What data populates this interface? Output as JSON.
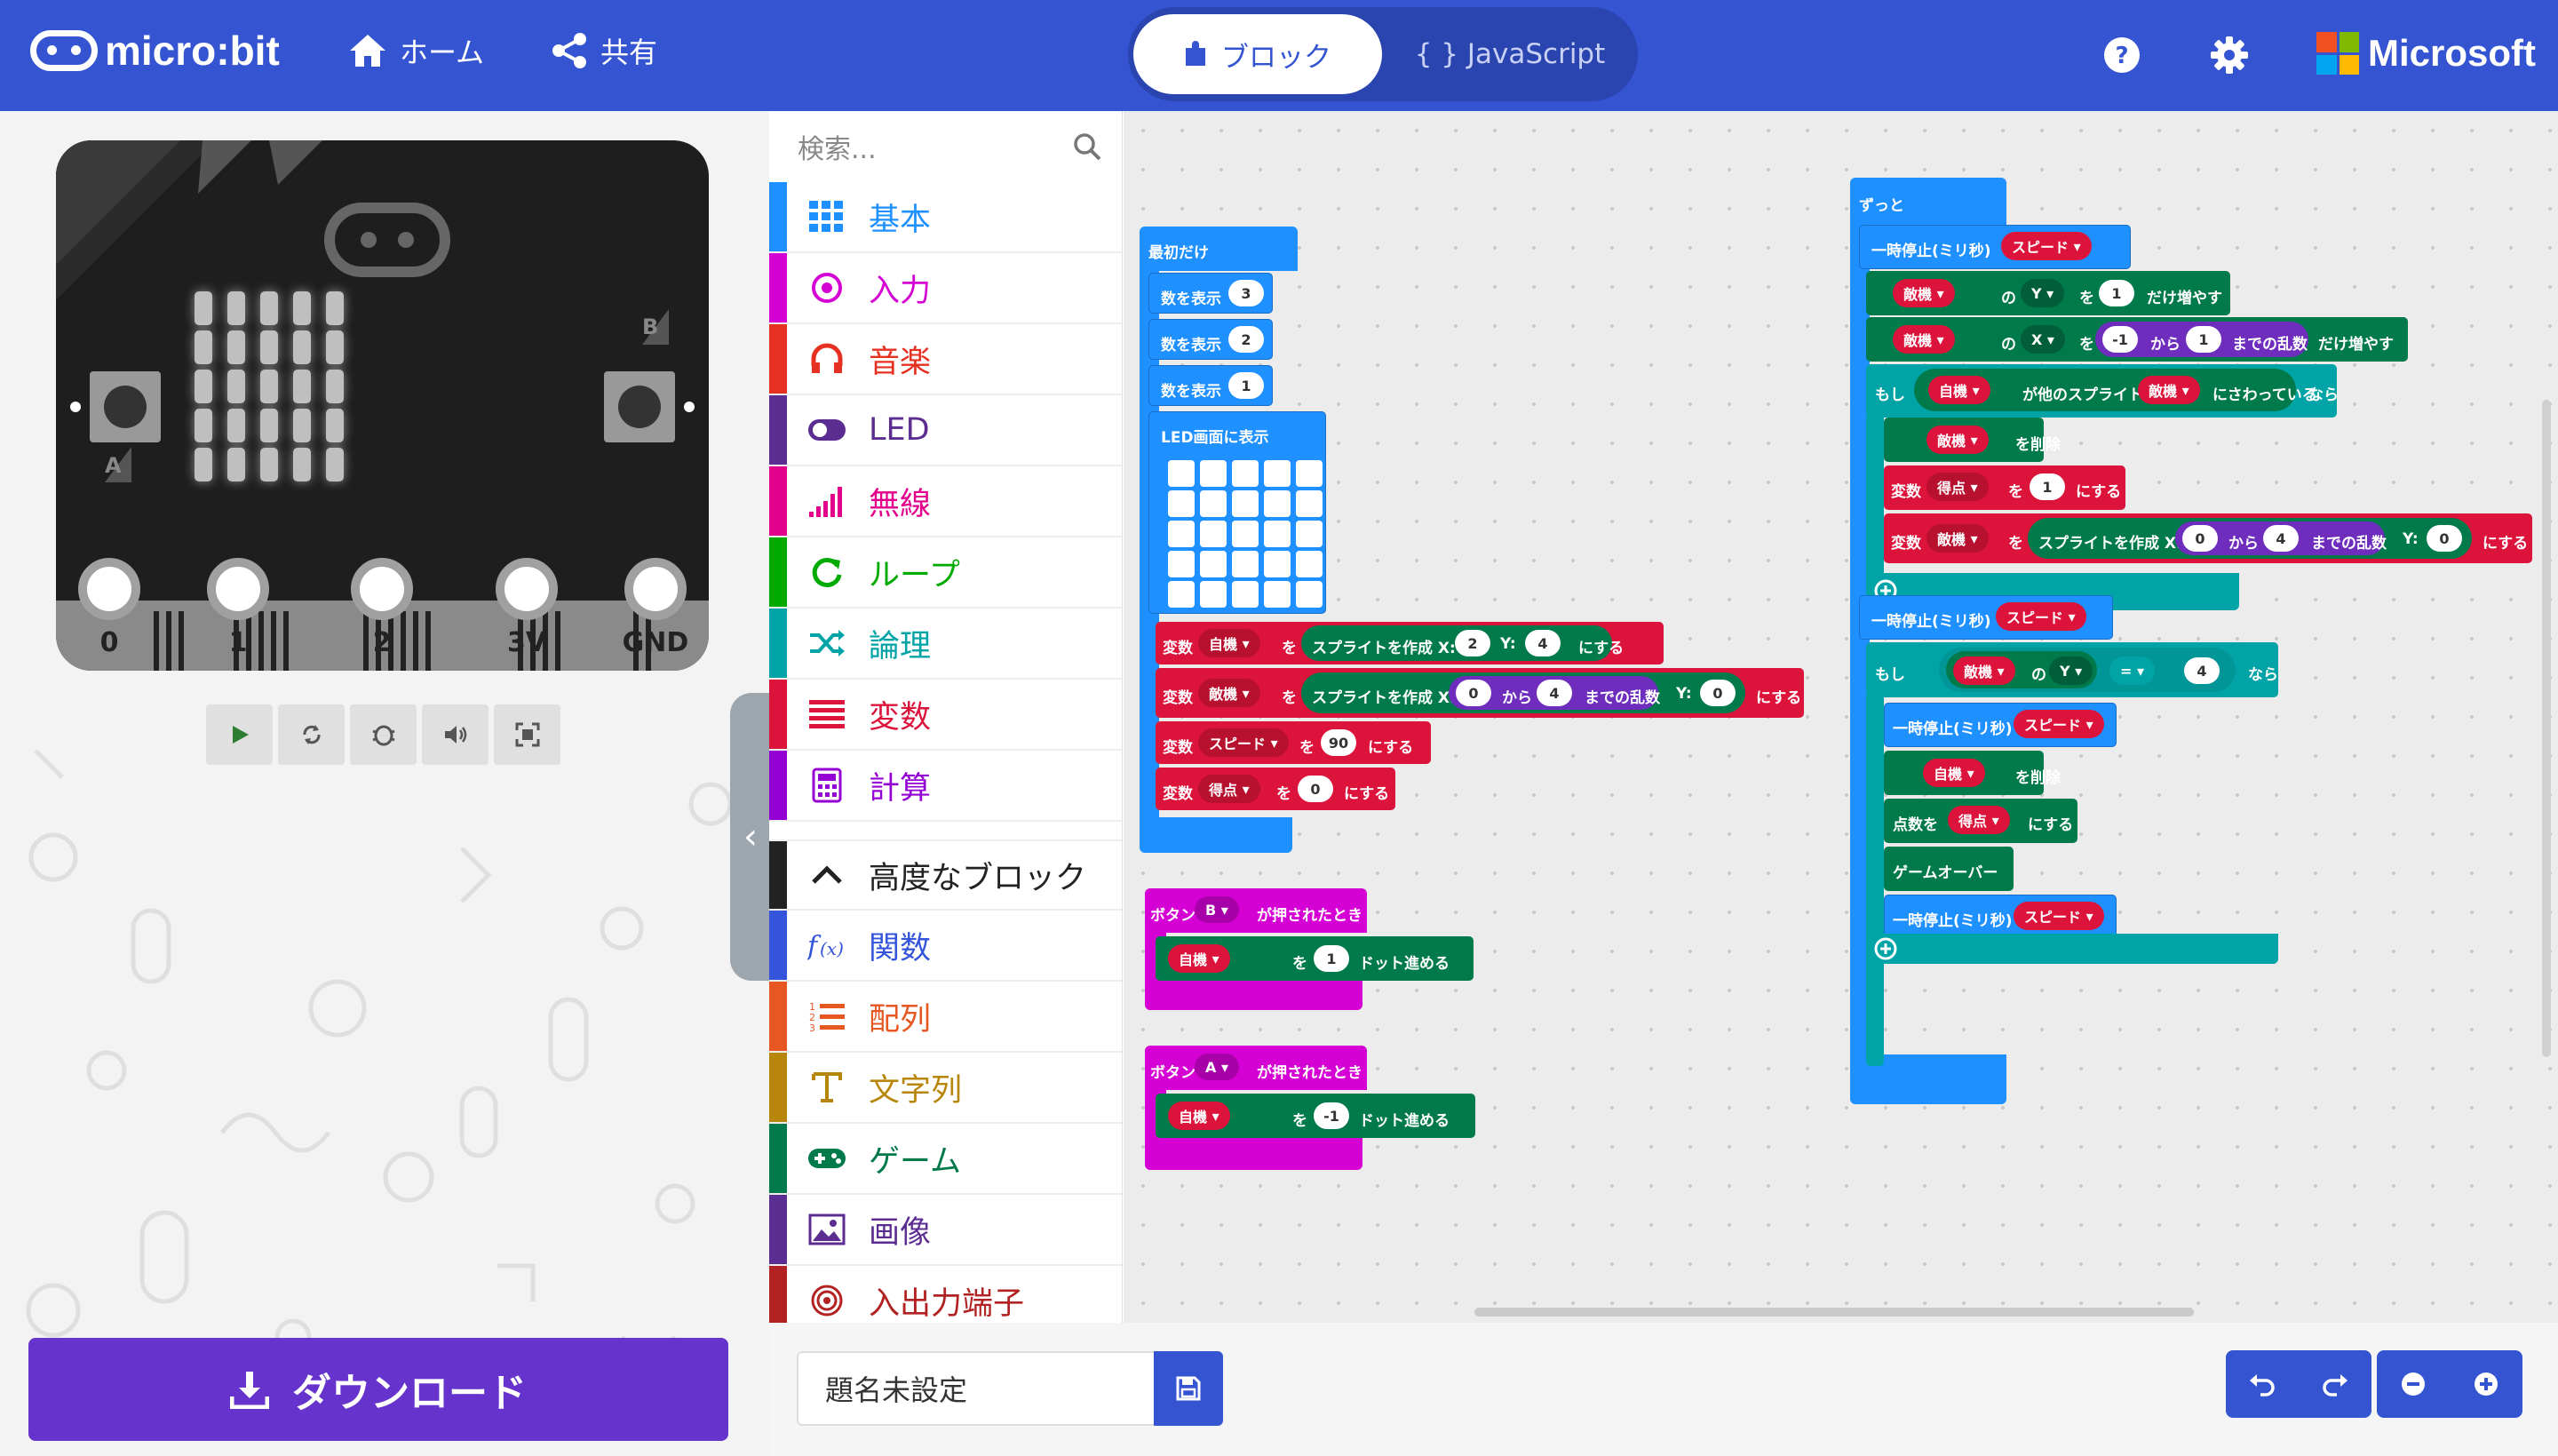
{
  "header": {
    "logo_text": "micro:bit",
    "home_label": "ホーム",
    "share_label": "共有",
    "mode_blocks": "ブロック",
    "mode_js": "{ } JavaScript",
    "ms_text": "Microsoft"
  },
  "simulator": {
    "pins": [
      "0",
      "1",
      "2",
      "3V",
      "GND"
    ],
    "button_a": "A",
    "button_b": "B",
    "controls": [
      "play-icon",
      "restart-icon",
      "debug-icon",
      "sound-icon",
      "fullscreen-icon"
    ]
  },
  "download_label": "ダウンロード",
  "toolbox": {
    "search_placeholder": "検索...",
    "categories": [
      {
        "label": "基本",
        "color": "#1e90ff",
        "icon": "grid-icon"
      },
      {
        "label": "入力",
        "color": "#d400d4",
        "icon": "input-icon"
      },
      {
        "label": "音楽",
        "color": "#e63022",
        "icon": "headphones-icon"
      },
      {
        "label": "LED",
        "color": "#5c2d91",
        "icon": "toggle-icon"
      },
      {
        "label": "無線",
        "color": "#e3008c",
        "icon": "signal-icon"
      },
      {
        "label": "ループ",
        "color": "#00aa00",
        "icon": "loop-icon"
      },
      {
        "label": "論理",
        "color": "#00a4a6",
        "icon": "shuffle-icon"
      },
      {
        "label": "変数",
        "color": "#dc143c",
        "icon": "list-lines-icon"
      },
      {
        "label": "計算",
        "color": "#9400d3",
        "icon": "calculator-icon"
      }
    ],
    "advanced_label": "高度なブロック",
    "advanced_categories": [
      {
        "label": "関数",
        "color": "#3455db",
        "icon": "function-icon"
      },
      {
        "label": "配列",
        "color": "#e65722",
        "icon": "ordered-list-icon"
      },
      {
        "label": "文字列",
        "color": "#b8860b",
        "icon": "text-icon"
      },
      {
        "label": "ゲーム",
        "color": "#007a4b",
        "icon": "gamepad-icon"
      },
      {
        "label": "画像",
        "color": "#5c2d91",
        "icon": "image-icon"
      },
      {
        "label": "入出力端子",
        "color": "#b22222",
        "icon": "pin-target-icon"
      }
    ]
  },
  "blocks": {
    "on_start": "最初だけ",
    "show_number": "数を表示",
    "n3": "3",
    "n2": "2",
    "n1": "1",
    "show_leds": "LED画面に表示",
    "var": "変数",
    "player": "自機",
    "enemy": "敵機",
    "speed": "スピード",
    "score": "得点",
    "to": "を",
    "set_to": "にする",
    "create_sprite": "スプライトを作成 X:",
    "y_label": "Y:",
    "from": "から",
    "random_upto": "までの乱数",
    "v2": "2",
    "v4": "4",
    "v0": "0",
    "v90": "90",
    "v1": "1",
    "vneg1": "-1",
    "btn_b_1": "ボタン",
    "btn_b_name": "B",
    "pressed": "が押されたとき",
    "btn_a_name": "A",
    "move_dots": "ドット進める",
    "forever": "ずっと",
    "pause_ms": "一時停止(ミリ秒)",
    "of": "の",
    "y": "Y",
    "x": "X",
    "change_by": "だけ増やす",
    "if": "もし",
    "touching_pre": "が他のスプライト",
    "touching_post": "にさわっている",
    "then": "なら",
    "delete": "を削除",
    "eq": "=",
    "score_set": "点数を",
    "game_over": "ゲームオーバー",
    "vneg1b": "-1"
  },
  "project_name_placeholder": "題名未設定"
}
